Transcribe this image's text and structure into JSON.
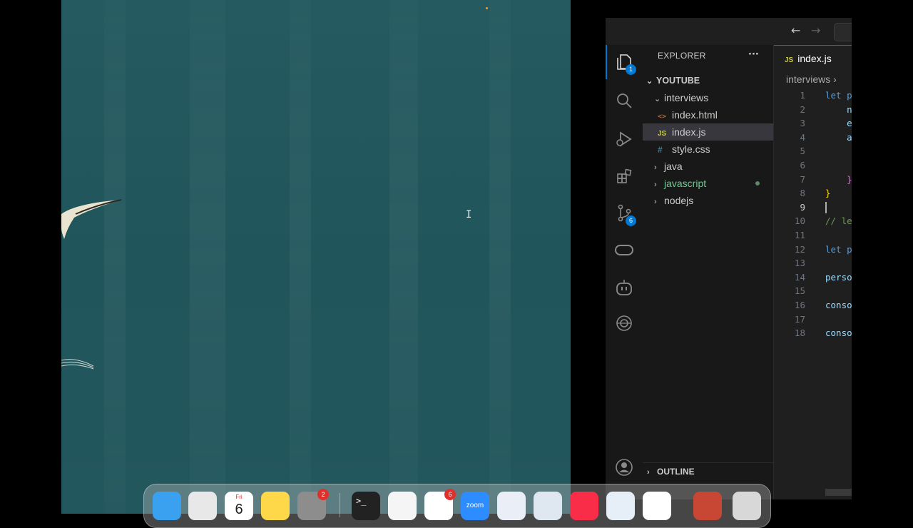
{
  "explorer": {
    "title": "EXPLORER",
    "more": "···",
    "root": "YOUTUBE",
    "items": [
      {
        "label": "interviews",
        "type": "folder-open",
        "indent": 1
      },
      {
        "label": "index.html",
        "type": "html",
        "indent": 2,
        "glyph": "<>"
      },
      {
        "label": "index.js",
        "type": "js",
        "indent": 2,
        "glyph": "JS",
        "selected": true
      },
      {
        "label": "style.css",
        "type": "css",
        "indent": 2,
        "glyph": "#"
      },
      {
        "label": "java",
        "type": "folder",
        "indent": 1
      },
      {
        "label": "javascript",
        "type": "folder",
        "indent": 1,
        "modified": true
      },
      {
        "label": "nodejs",
        "type": "folder",
        "indent": 1
      }
    ],
    "outline": "OUTLINE"
  },
  "activity_bar": {
    "explorer_badge": "1",
    "source_control_badge": "6",
    "icons": [
      "files-icon",
      "search-icon",
      "run-debug-icon",
      "extensions-icon",
      "source-control-icon",
      "remote-icon",
      "copilot-icon",
      "openai-icon",
      "account-icon",
      "settings-icon"
    ]
  },
  "editor": {
    "tab_label": "index.js",
    "tab_glyph": "JS",
    "breadcrumb": "interviews",
    "breadcrumb_sep": "›",
    "lines": [
      {
        "n": "1",
        "text": "let p",
        "color": "#569cd6"
      },
      {
        "n": "2",
        "text": "    n",
        "color": "#9cdcfe"
      },
      {
        "n": "3",
        "text": "    e",
        "color": "#9cdcfe"
      },
      {
        "n": "4",
        "text": "    a",
        "color": "#9cdcfe"
      },
      {
        "n": "5",
        "text": "",
        "color": "#cccccc"
      },
      {
        "n": "6",
        "text": "",
        "color": "#cccccc"
      },
      {
        "n": "7",
        "text": "    }",
        "color": "#da70d6"
      },
      {
        "n": "8",
        "text": "}",
        "color": "#ffd700"
      },
      {
        "n": "9",
        "text": "",
        "color": "#cccccc",
        "current": true
      },
      {
        "n": "10",
        "text": "// le",
        "color": "#6a9955"
      },
      {
        "n": "11",
        "text": "",
        "color": "#cccccc"
      },
      {
        "n": "12",
        "text": "let p",
        "color": "#569cd6"
      },
      {
        "n": "13",
        "text": "",
        "color": "#cccccc"
      },
      {
        "n": "14",
        "text": "perso",
        "color": "#9cdcfe"
      },
      {
        "n": "15",
        "text": "",
        "color": "#cccccc"
      },
      {
        "n": "16",
        "text": "conso",
        "color": "#9cdcfe"
      },
      {
        "n": "17",
        "text": "",
        "color": "#cccccc"
      },
      {
        "n": "18",
        "text": "conso",
        "color": "#9cdcfe"
      }
    ]
  },
  "titlebar": {
    "back": "←",
    "forward": "→"
  },
  "dock": {
    "apps": [
      {
        "name": "finder",
        "bg": "#3aa0f0"
      },
      {
        "name": "launchpad",
        "bg": "#e8e8e8"
      },
      {
        "name": "calendar",
        "bg": "#ffffff",
        "day": "Fri",
        "date": "6"
      },
      {
        "name": "notes",
        "bg": "#ffd84a"
      },
      {
        "name": "system-settings",
        "bg": "#8d8d8d",
        "badge": "2"
      },
      {
        "name": "terminal",
        "bg": "#222222",
        "glyph": ">_"
      },
      {
        "name": "vscode",
        "bg": "#f5f5f5"
      },
      {
        "name": "slack",
        "bg": "#ffffff",
        "badge": "6"
      },
      {
        "name": "zoom",
        "bg": "#2d8cff",
        "label": "zoom"
      },
      {
        "name": "outlook",
        "bg": "#e9eef7"
      },
      {
        "name": "automator",
        "bg": "#dfe8f0"
      },
      {
        "name": "music",
        "bg": "#fa2d48"
      },
      {
        "name": "quicktime",
        "bg": "#e6eef8"
      },
      {
        "name": "chrome",
        "bg": "#ffffff"
      },
      {
        "name": "oracle",
        "bg": "#c74634"
      },
      {
        "name": "trash",
        "bg": "#d8d8d8"
      }
    ]
  },
  "colors": {
    "wallpaper": "#22575d",
    "accent": "#0078d4",
    "editor_bg": "#1f1f1f",
    "sidebar_bg": "#181818",
    "modified_dot": "#73c991",
    "js_yellow": "#cbcb41"
  }
}
